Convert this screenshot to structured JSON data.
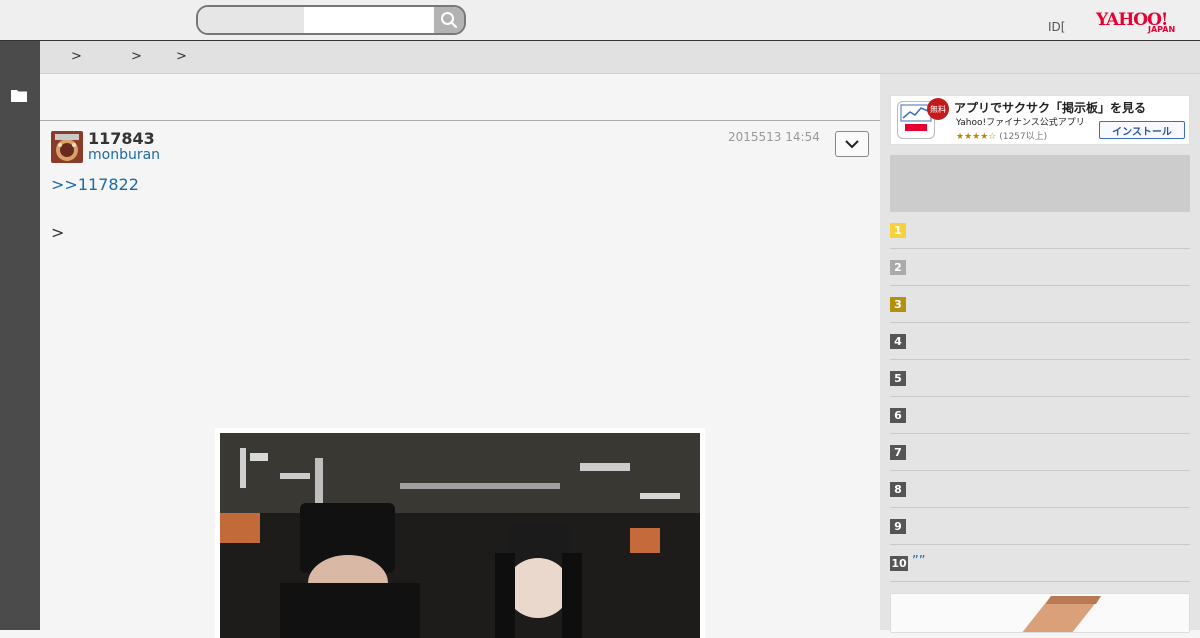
{
  "header": {
    "search": {
      "placeholder": "",
      "value": ""
    },
    "id_text": "ID[",
    "logo": {
      "main": "YAHOO!",
      "sub": "JAPAN"
    }
  },
  "breadcrumb": {
    "separators": [
      ">",
      ">",
      ">"
    ]
  },
  "post": {
    "number": "117843",
    "author": "monburan",
    "date": "2015513 14:54",
    "reply_link": ">>117822",
    "quote": ">"
  },
  "sidebar": {
    "app_banner": {
      "badge": "無料",
      "title": "アプリでサクサク「掲示板」を見る",
      "subtitle": "Yahoo!ファイナンス公式アプリ",
      "stars": "★★★★☆",
      "count": "(1257以上)",
      "install_label": "インストール"
    },
    "ranking": [
      {
        "num": "1",
        "color": "#f5d23c",
        "text": ""
      },
      {
        "num": "2",
        "color": "#aaaaaa",
        "text": ""
      },
      {
        "num": "3",
        "color": "#b5900f",
        "text": ""
      },
      {
        "num": "4",
        "color": "#555555",
        "text": ""
      },
      {
        "num": "5",
        "color": "#555555",
        "text": ""
      },
      {
        "num": "6",
        "color": "#555555",
        "text": ""
      },
      {
        "num": "7",
        "color": "#555555",
        "text": ""
      },
      {
        "num": "8",
        "color": "#555555",
        "text": ""
      },
      {
        "num": "9",
        "color": "#555555",
        "text": ""
      },
      {
        "num": "10",
        "color": "#555555",
        "text": "”” "
      }
    ]
  },
  "icons": {
    "search": "search-icon",
    "folder": "folder-icon",
    "dropdown": "chevron-down-icon"
  },
  "colors": {
    "link": "#1d6aa5",
    "leftbar": "#4b4b4b",
    "logo_red": "#e60033"
  }
}
